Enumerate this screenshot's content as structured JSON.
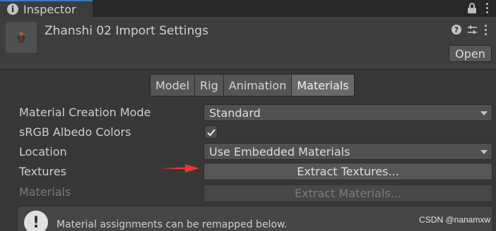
{
  "window": {
    "tab_icon": "info-icon",
    "tab_title": "Inspector",
    "tab_icon_glyph": "i"
  },
  "header": {
    "title": "Zhanshi 02 Import Settings",
    "help_glyph": "?",
    "open_label": "Open"
  },
  "tabs": [
    {
      "label": "Model",
      "active": false
    },
    {
      "label": "Rig",
      "active": false
    },
    {
      "label": "Animation",
      "active": false
    },
    {
      "label": "Materials",
      "active": true
    }
  ],
  "fields": {
    "material_creation_mode_label": "Material Creation Mode",
    "material_creation_mode_value": "Standard",
    "srgb_label": "sRGB Albedo Colors",
    "srgb_checked": true,
    "location_label": "Location",
    "location_value": "Use Embedded Materials",
    "textures_label": "Textures",
    "extract_textures_label": "Extract Textures...",
    "materials_label": "Materials",
    "extract_materials_label": "Extract Materials..."
  },
  "helpbox": {
    "icon_glyph": "!",
    "text": "Material assignments can be remapped below."
  },
  "watermark": "CSDN @nanamxw",
  "colors": {
    "accent": "#3a79bb",
    "arrow": "#e53935"
  }
}
